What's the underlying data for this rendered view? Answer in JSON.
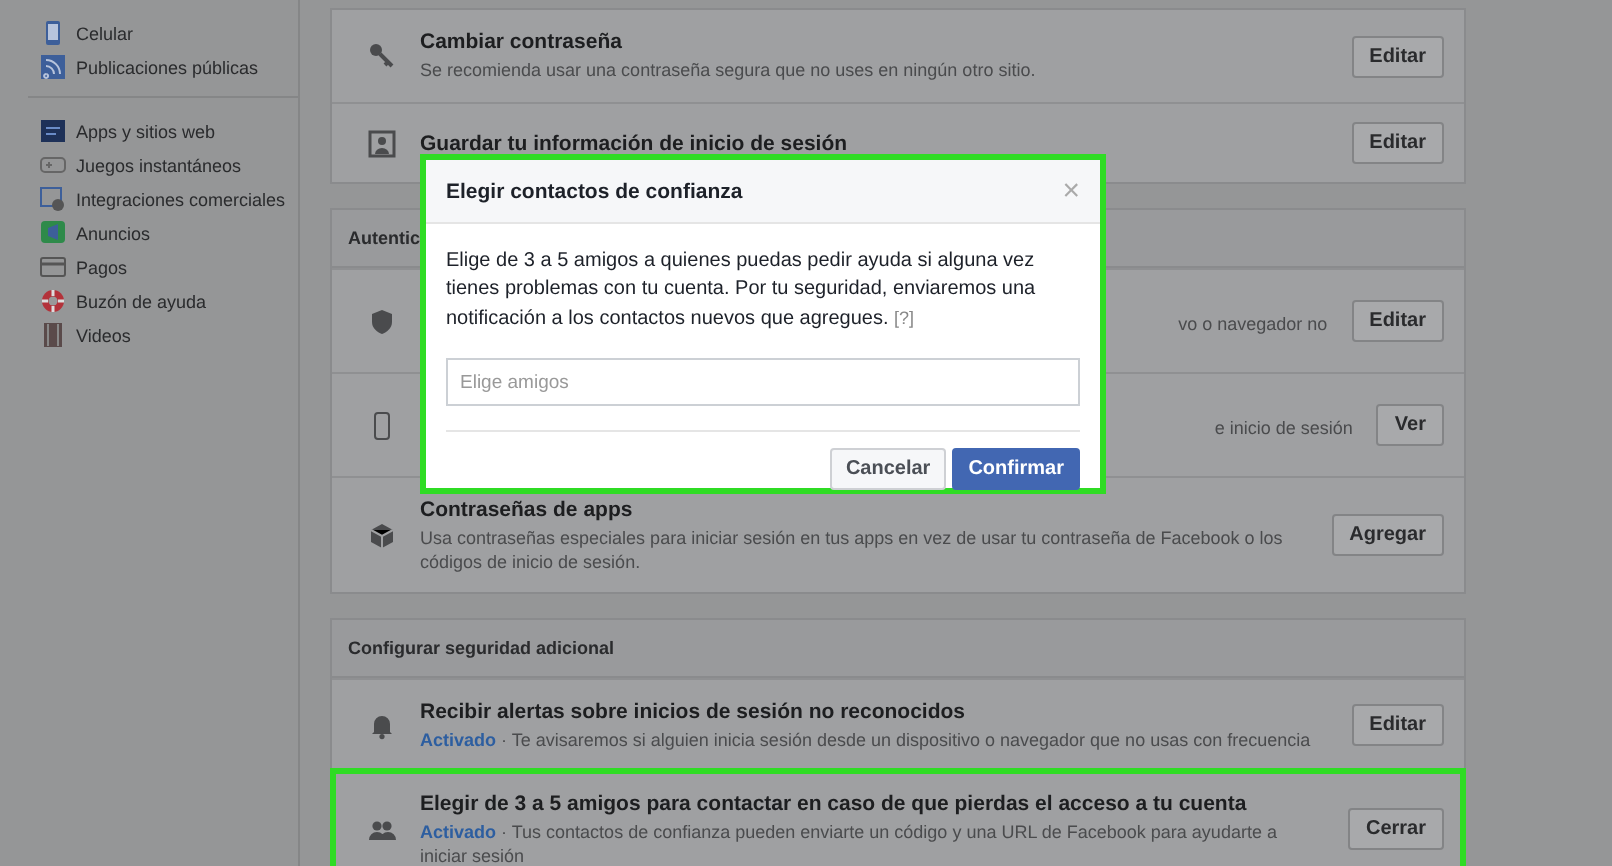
{
  "sidebar": {
    "groups": [
      {
        "items": [
          {
            "label": "Celular"
          },
          {
            "label": "Publicaciones públicas"
          }
        ]
      },
      {
        "items": [
          {
            "label": "Apps y sitios web"
          },
          {
            "label": "Juegos instantáneos"
          },
          {
            "label": "Integraciones comerciales"
          },
          {
            "label": "Anuncios"
          },
          {
            "label": "Pagos"
          },
          {
            "label": "Buzón de ayuda"
          },
          {
            "label": "Videos"
          }
        ]
      }
    ]
  },
  "sections": [
    {
      "rows": [
        {
          "title": "Cambiar contraseña",
          "description": "Se recomienda usar una contraseña segura que no uses en ningún otro sitio.",
          "button": "Editar",
          "highlighted": false
        },
        {
          "title": "Guardar tu información de inicio de sesión",
          "button": "Editar",
          "highlighted": false
        }
      ]
    },
    {
      "header": "Autentic",
      "rows": [
        {
          "description_right": "vo o navegador no",
          "button": "Editar",
          "highlighted": false
        },
        {
          "description_right": "e inicio de sesión",
          "button": "Ver",
          "highlighted": false
        },
        {
          "title": "Contraseñas de apps",
          "description": "Usa contraseñas especiales para iniciar sesión en tus apps en vez de usar tu contraseña de Facebook o los códigos de inicio de sesión.",
          "button": "Agregar",
          "highlighted": false
        }
      ]
    },
    {
      "header": "Configurar seguridad adicional",
      "rows": [
        {
          "title": "Recibir alertas sobre inicios de sesión no reconocidos",
          "status": "Activado",
          "separator": "·",
          "description": "Te avisaremos si alguien inicia sesión desde un dispositivo o navegador que no usas con frecuencia",
          "button": "Editar",
          "highlighted": false
        },
        {
          "title": "Elegir de 3 a 5 amigos para contactar en caso de que pierdas el acceso a tu cuenta",
          "status": "Activado",
          "separator": "·",
          "description": "Tus contactos de confianza pueden enviarte un código y una URL de Facebook para ayudarte a iniciar sesión",
          "button": "Cerrar",
          "highlighted": true
        }
      ]
    }
  ],
  "dialog": {
    "title": "Elegir contactos de confianza",
    "close": "×",
    "highlighted": true,
    "body": "Elige de 3 a 5 amigos a quienes puedas pedir ayuda si alguna vez tienes problemas con tu cuenta. Por tu seguridad, enviaremos una notificación a los contactos nuevos que agregues.",
    "help_link": "[?]",
    "input": {
      "placeholder": "Elige amigos"
    },
    "buttons": [
      {
        "label": "Cancelar",
        "kind": "secondary"
      },
      {
        "label": "Confirmar",
        "kind": "primary"
      }
    ]
  }
}
